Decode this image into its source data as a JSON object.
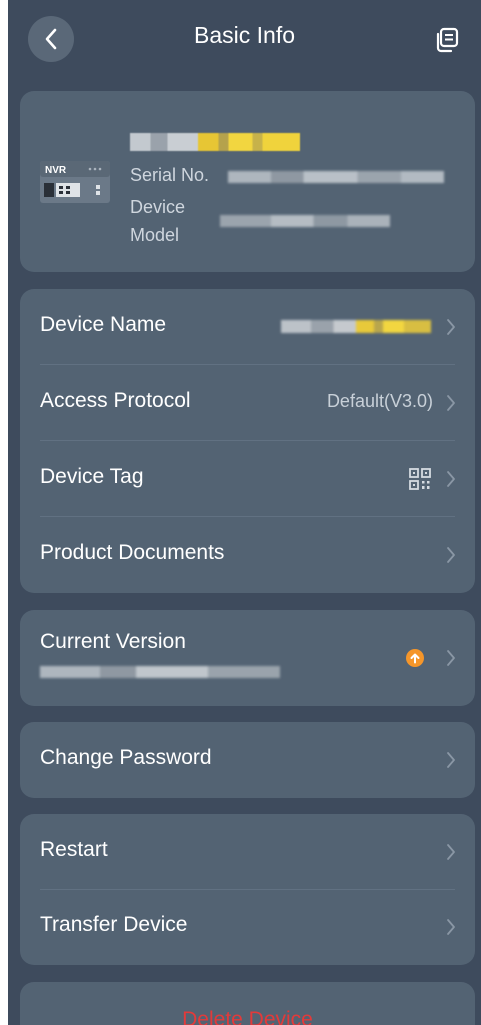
{
  "header": {
    "title": "Basic Info"
  },
  "device": {
    "badge": "NVR",
    "serial_label": "Serial No.",
    "model_label_line1": "Device",
    "model_label_line2": "Model"
  },
  "settings": {
    "items": [
      {
        "label": "Device Name"
      },
      {
        "label": "Access Protocol",
        "value": "Default(V3.0)"
      },
      {
        "label": "Device Tag"
      },
      {
        "label": "Product Documents"
      }
    ]
  },
  "version": {
    "label": "Current Version",
    "update_badge_color": "#f5962a"
  },
  "password": {
    "label": "Change Password"
  },
  "maintenance": {
    "items": [
      {
        "label": "Restart"
      },
      {
        "label": "Transfer Device"
      }
    ]
  },
  "delete": {
    "label": "Delete Device",
    "color": "#e23a3a"
  },
  "colors": {
    "background": "#3e4b5d",
    "card": "#536373",
    "accent_yellow": "#f0d33c"
  }
}
